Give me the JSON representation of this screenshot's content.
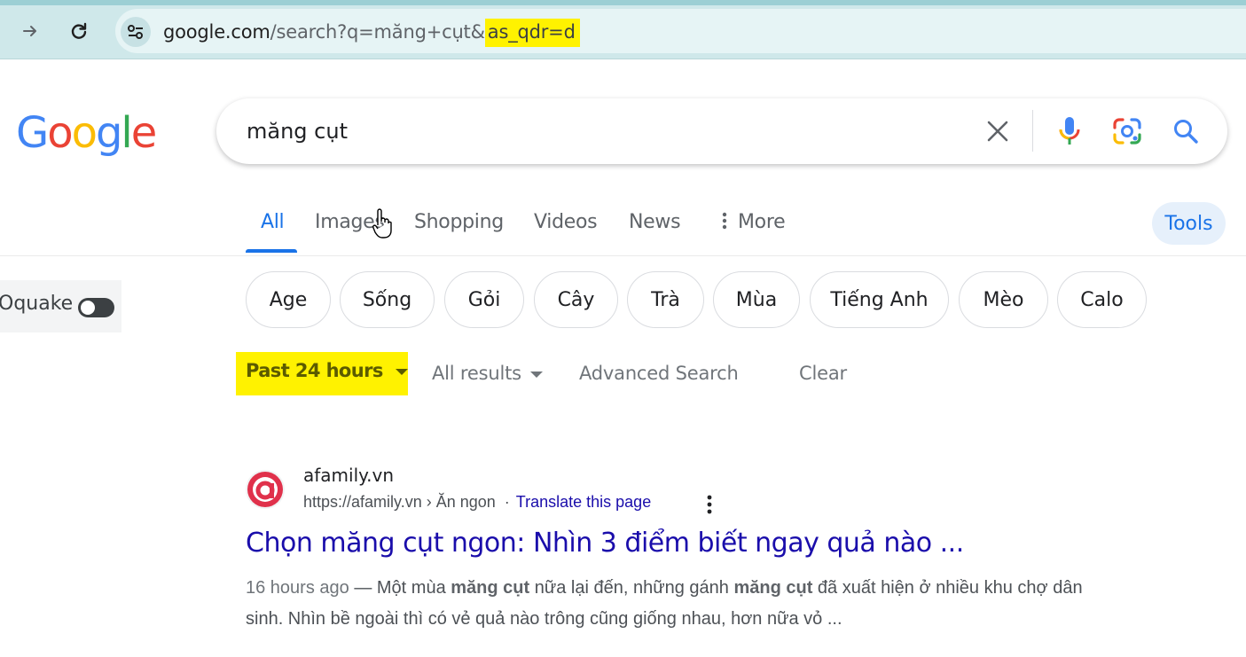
{
  "browser": {
    "url_host": "google.com",
    "url_path": "/search?q=măng+cụt&",
    "url_highlight": "as_qdr=d",
    "forward_icon": "arrow-right-icon",
    "reload_icon": "reload-icon",
    "site_info_icon": "tune-icon"
  },
  "logo_letters": [
    "G",
    "o",
    "o",
    "g",
    "l",
    "e"
  ],
  "logo_colors": [
    "#4285F4",
    "#EA4335",
    "#FBBC05",
    "#4285F4",
    "#34A853",
    "#EA4335"
  ],
  "search": {
    "query": "măng cụt",
    "clear_icon": "close-icon",
    "voice_icon": "mic-icon",
    "lens_icon": "camera-lens-icon",
    "search_icon": "search-icon"
  },
  "tabs": {
    "all": "All",
    "images": "Images",
    "shopping": "Shopping",
    "videos": "Videos",
    "news": "News",
    "more": "More",
    "tools": "Tools"
  },
  "side": {
    "label": "Oquake"
  },
  "chips": [
    "Age",
    "Sống",
    "Gỏi",
    "Cây",
    "Trà",
    "Mùa",
    "Tiếng Anh",
    "Mèo",
    "Calo"
  ],
  "tools_row": {
    "time_filter": "Past 24 hours",
    "results_filter": "All results",
    "advanced": "Advanced Search",
    "clear": "Clear"
  },
  "result": {
    "site_name": "afamily.vn",
    "url": "https://afamily.vn › Ăn ngon",
    "translate": "Translate this page",
    "title": "Chọn măng cụt ngon: Nhìn 3 điểm biết ngay quả nào ...",
    "date": "16 hours ago",
    "dash": " — ",
    "snip_1": "Một mùa ",
    "snip_b1": "măng cụt",
    "snip_2": " nữa lại đến, những gánh ",
    "snip_b2": "măng cụt",
    "snip_3": " đã xuất hiện ở nhiều khu chợ dân sinh. Nhìn bề ngoài thì có vẻ quả nào trông cũng giống nhau, hơn nữa vỏ ...",
    "favicon_letter": "a"
  }
}
